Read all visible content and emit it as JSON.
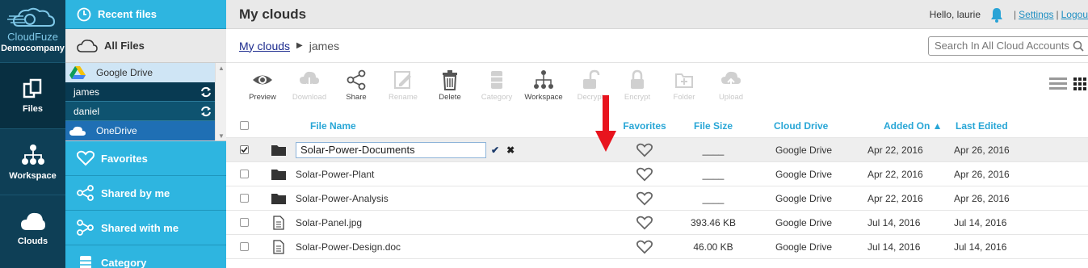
{
  "brand": {
    "logo_name": "CloudFuze",
    "company": "Democompany"
  },
  "rail": {
    "items": [
      {
        "label": "Files"
      },
      {
        "label": "Workspace"
      },
      {
        "label": "Clouds"
      }
    ]
  },
  "panel": {
    "recent_files": "Recent files",
    "all_files": "All Files",
    "tree": {
      "google_drive": "Google Drive",
      "accounts": [
        "james",
        "daniel"
      ],
      "onedrive": "OneDrive"
    },
    "items": [
      {
        "label": "Favorites"
      },
      {
        "label": "Shared by me"
      },
      {
        "label": "Shared with me"
      },
      {
        "label": "Category"
      }
    ]
  },
  "header": {
    "title": "My clouds",
    "hello": "Hello, laurie",
    "settings": "Settings",
    "logout": "Logou",
    "separator": "|"
  },
  "breadcrumb": {
    "root": "My clouds",
    "current": "james"
  },
  "search": {
    "placeholder": "Search In All Cloud Accounts"
  },
  "toolbar": {
    "preview": "Preview",
    "download": "Download",
    "share": "Share",
    "rename": "Rename",
    "delete": "Delete",
    "category": "Category",
    "workspace": "Workspace",
    "decrypt": "Decrypt",
    "encrypt": "Encrypt",
    "folder": "Folder",
    "upload": "Upload"
  },
  "table": {
    "headers": {
      "name": "File Name",
      "favorites": "Favorites",
      "size": "File Size",
      "cloud": "Cloud Drive",
      "added": "Added On ▲",
      "edited": "Last Edited"
    },
    "rename_value": "Solar-Power-Documents",
    "rows": [
      {
        "name": "Solar-Power-Documents",
        "type": "folder",
        "size": "____",
        "cloud": "Google Drive",
        "added": "Apr 22, 2016",
        "edited": "Apr 26, 2016",
        "checked": true
      },
      {
        "name": "Solar-Power-Plant",
        "type": "folder",
        "size": "____",
        "cloud": "Google Drive",
        "added": "Apr 22, 2016",
        "edited": "Apr 26, 2016",
        "checked": false
      },
      {
        "name": "Solar-Power-Analysis",
        "type": "folder",
        "size": "____",
        "cloud": "Google Drive",
        "added": "Apr 22, 2016",
        "edited": "Apr 26, 2016",
        "checked": false
      },
      {
        "name": "Solar-Panel.jpg",
        "type": "file",
        "size": "393.46 KB",
        "cloud": "Google Drive",
        "added": "Jul 14, 2016",
        "edited": "Jul 14, 2016",
        "checked": false
      },
      {
        "name": "Solar-Power-Design.doc",
        "type": "file",
        "size": "46.00 KB",
        "cloud": "Google Drive",
        "added": "Jul 14, 2016",
        "edited": "Jul 14, 2016",
        "checked": false
      }
    ]
  },
  "colors": {
    "rail_bg": "#0e3f56",
    "panel_accent": "#2eb5e0",
    "header_text": "#28a6d6",
    "arrow": "#e8141e"
  }
}
